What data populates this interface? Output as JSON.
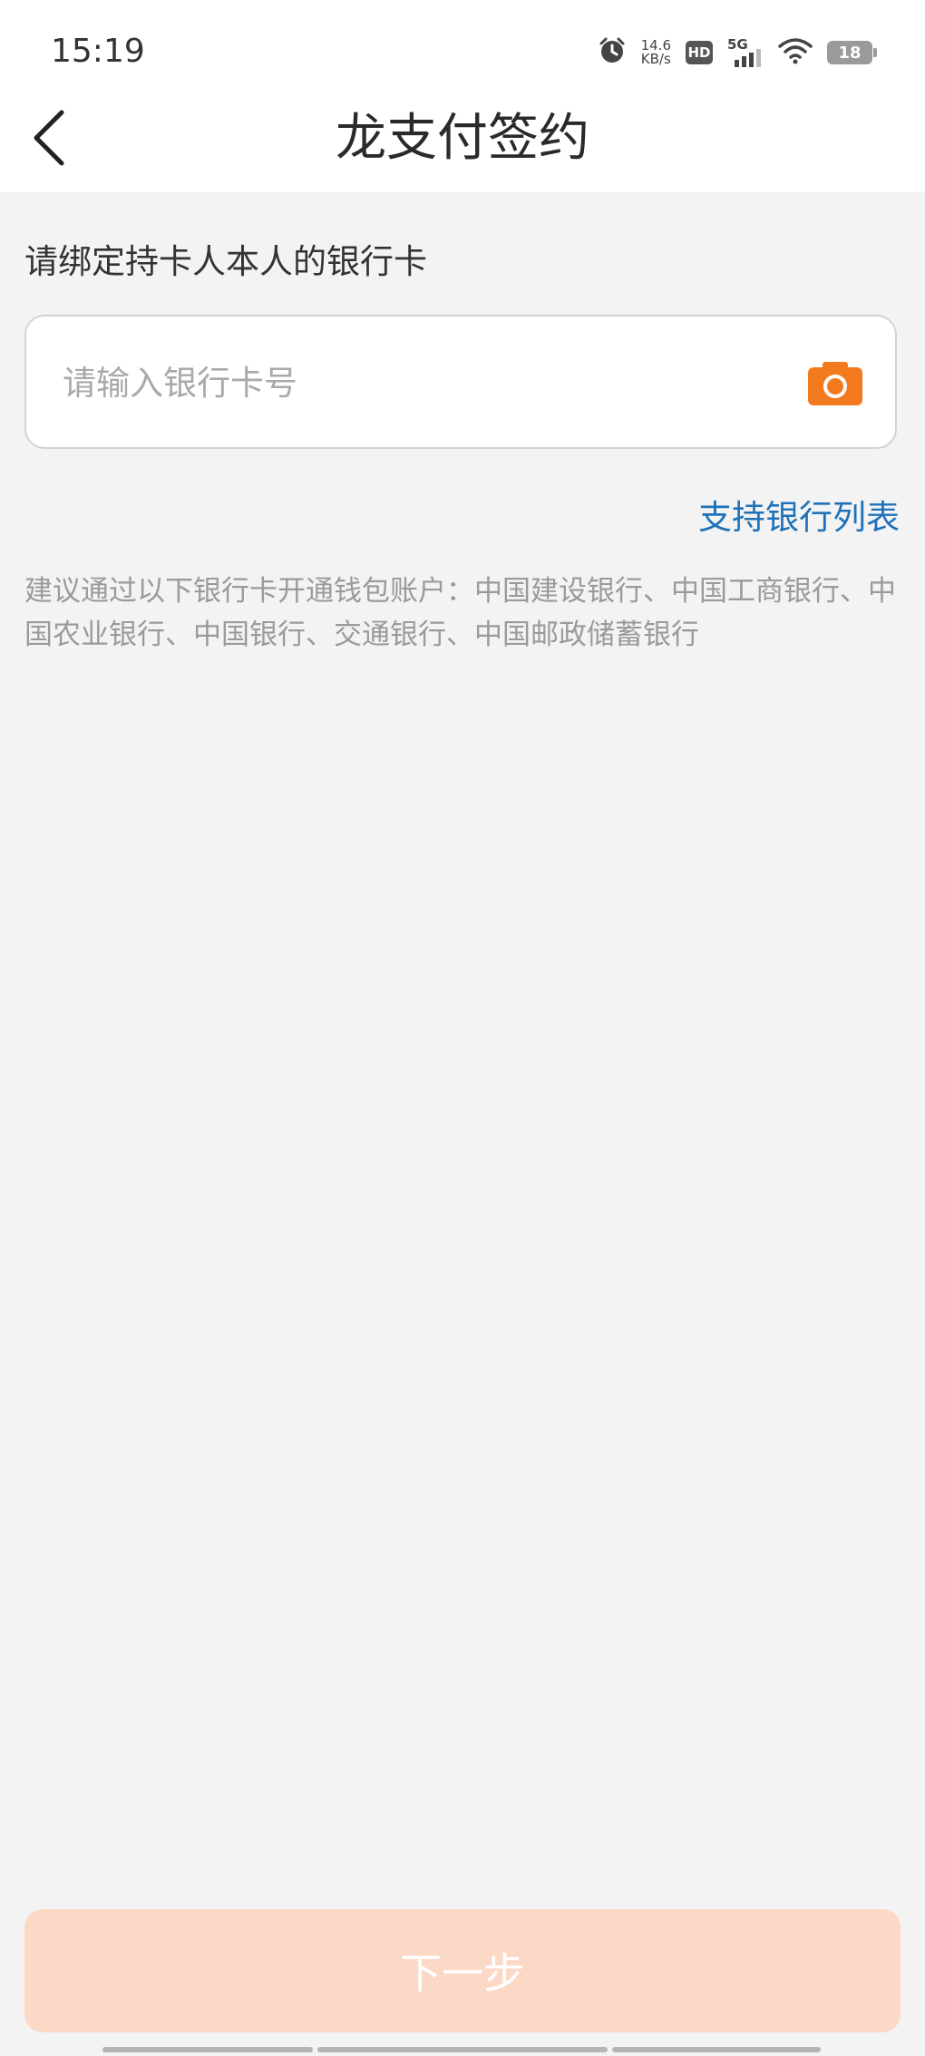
{
  "status": {
    "time": "15:19",
    "net_speed_value": "14.6",
    "net_speed_unit": "KB/s",
    "hd": "HD",
    "network": "5G",
    "battery": "18"
  },
  "header": {
    "title": "龙支付签约"
  },
  "form": {
    "prompt": "请绑定持卡人本人的银行卡",
    "card_placeholder": "请输入银行卡号",
    "card_value": "",
    "bank_list_link": "支持银行列表",
    "hint": "建议通过以下银行卡开通钱包账户：中国建设银行、中国工商银行、中国农业银行、中国银行、交通银行、中国邮政储蓄银行"
  },
  "footer": {
    "next_label": "下一步"
  },
  "colors": {
    "accent_orange": "#f47a20",
    "link_blue": "#1f72b8",
    "button_disabled": "#fcd9c6"
  }
}
